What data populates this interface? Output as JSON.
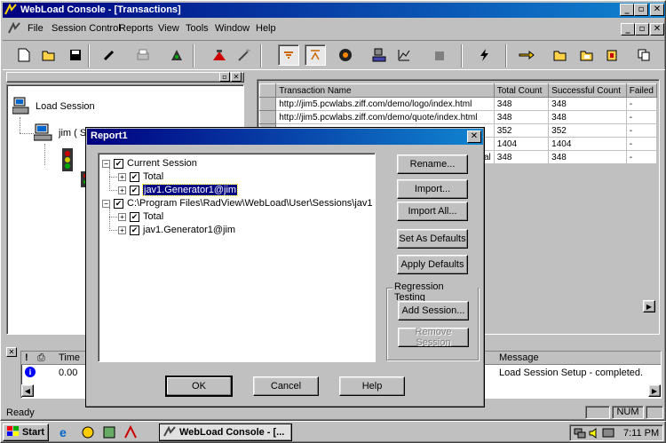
{
  "window": {
    "title": "WebLoad Console - [Transactions]"
  },
  "menu": [
    "File",
    "Session Control",
    "Reports",
    "View",
    "Tools",
    "Window",
    "Help"
  ],
  "left_tree": {
    "root": "Load Session",
    "child": "jim ( ST"
  },
  "transactions": {
    "columns": [
      "Transaction Name",
      "Total Count",
      "Successful Count",
      "Failed"
    ],
    "rows": [
      [
        "http://jim5.pcwlabs.ziff.com/demo/logo/index.html",
        "348",
        "348",
        "-"
      ],
      [
        "http://jim5.pcwlabs.ziff.com/demo/quote/index.html",
        "348",
        "348",
        "-"
      ],
      [
        "",
        "352",
        "352",
        "-"
      ],
      [
        "",
        "1404",
        "1404",
        "-"
      ],
      [
        "al",
        "348",
        "348",
        "-"
      ]
    ]
  },
  "log": {
    "col_time": "Time",
    "col_message": "Message",
    "row_time": "0.00",
    "row_message": "Load Session Setup - completed."
  },
  "status": {
    "text": "Ready",
    "num": "NUM"
  },
  "taskbar": {
    "start": "Start",
    "task": "WebLoad Console - [...",
    "clock": "7:11 PM"
  },
  "dialog": {
    "title": "Report1",
    "tree": [
      {
        "indent": 0,
        "expander": "−",
        "checked": true,
        "label": "Current Session",
        "selected": false
      },
      {
        "indent": 1,
        "expander": "+",
        "checked": true,
        "label": "Total",
        "selected": false
      },
      {
        "indent": 1,
        "expander": "+",
        "checked": true,
        "label": "jav1.Generator1@jim",
        "selected": true
      },
      {
        "indent": 0,
        "expander": "−",
        "checked": true,
        "label": "C:\\Program Files\\RadView\\WebLoad\\User\\Sessions\\jav1",
        "selected": false
      },
      {
        "indent": 1,
        "expander": "+",
        "checked": true,
        "label": "Total",
        "selected": false
      },
      {
        "indent": 1,
        "expander": "+",
        "checked": true,
        "label": "jav1.Generator1@jim",
        "selected": false
      }
    ],
    "buttons": {
      "rename": "Rename...",
      "import": "Import...",
      "import_all": "Import All...",
      "set_defaults": "Set As Defaults",
      "apply_defaults": "Apply Defaults",
      "regression_group": "Regression Testing",
      "add_session": "Add Session...",
      "remove_session": "Remove Session",
      "ok": "OK",
      "cancel": "Cancel",
      "help": "Help"
    }
  }
}
